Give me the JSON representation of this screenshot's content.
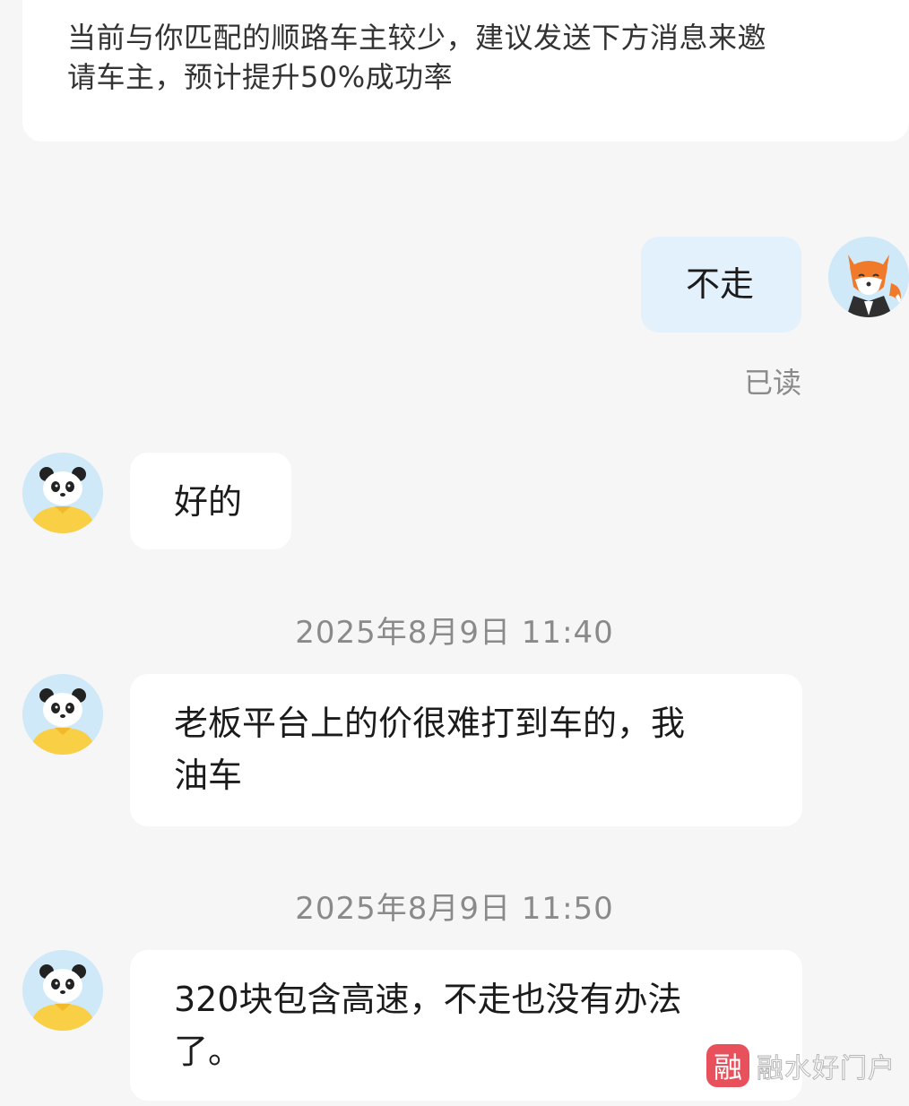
{
  "system_notice": {
    "line1": "当前与你匹配的顺路车主较少，建议发送下方消息来邀",
    "line2": "请车主，预计提升50%成功率"
  },
  "messages": {
    "sent_1": {
      "text": "不走",
      "status": "已读"
    },
    "recv_1": {
      "text": "好的"
    },
    "time_1": "2025年8月9日 11:40",
    "recv_2": {
      "line1": "老板平台上的价很难打到车的，我",
      "line2": "油车"
    },
    "time_2": "2025年8月9日 11:50",
    "recv_3": {
      "line1": "320块包含高速，不走也没有办法",
      "line2": "了。"
    }
  },
  "avatars": {
    "self": "fox-avatar-icon",
    "driver": "panda-avatar-icon"
  },
  "watermark": {
    "logo_char": "融",
    "text": "融水好门户"
  },
  "colors": {
    "background": "#f6f6f6",
    "incoming_bubble": "#ffffff",
    "outgoing_bubble": "#e3f1fd",
    "meta_text": "#8a8a8a",
    "watermark_red": "#e8505b"
  }
}
